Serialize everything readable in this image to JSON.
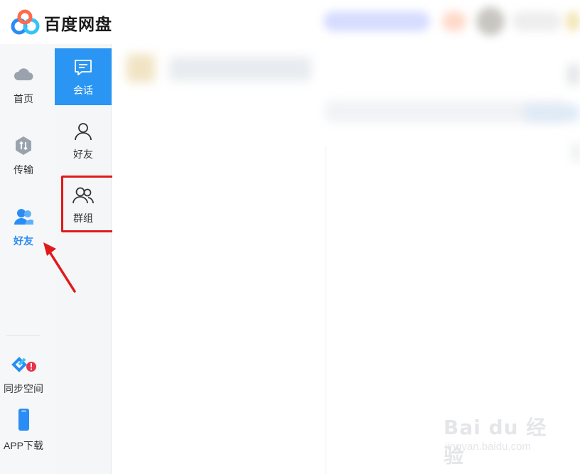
{
  "app": {
    "name": "百度网盘"
  },
  "leftnav": {
    "items": [
      {
        "label": "首页"
      },
      {
        "label": "传输"
      },
      {
        "label": "好友"
      },
      {
        "label": "同步空间"
      },
      {
        "label": "APP下载"
      }
    ]
  },
  "subnav": {
    "items": [
      {
        "label": "会话"
      },
      {
        "label": "好友"
      },
      {
        "label": "群组"
      }
    ]
  },
  "watermark": {
    "main": "Bai du 经验",
    "sub": "jingyan.baidu.com"
  },
  "colors": {
    "accent": "#2a95f3",
    "highlight": "#e01a1a",
    "nav_bg": "#f6f7f9"
  }
}
